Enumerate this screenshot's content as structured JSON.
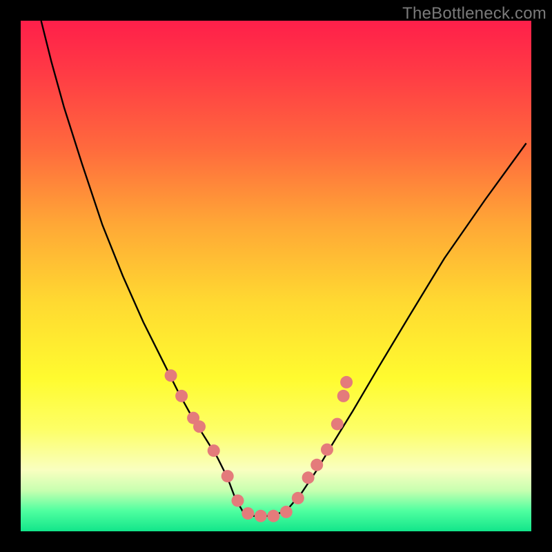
{
  "watermark": "TheBottleneck.com",
  "chart_data": {
    "type": "line",
    "title": "",
    "xlabel": "",
    "ylabel": "",
    "xlim": [
      0,
      1
    ],
    "ylim": [
      0,
      1
    ],
    "grid": false,
    "legend": false,
    "series": [
      {
        "name": "curve",
        "color": "#000000",
        "x": [
          0.04,
          0.06,
          0.085,
          0.12,
          0.16,
          0.2,
          0.24,
          0.28,
          0.31,
          0.335,
          0.36,
          0.385,
          0.405,
          0.42,
          0.44,
          0.46,
          0.49,
          0.52,
          0.55,
          0.58,
          0.61,
          0.65,
          0.7,
          0.76,
          0.83,
          0.91,
          0.99
        ],
        "y": [
          1.0,
          0.92,
          0.83,
          0.72,
          0.6,
          0.5,
          0.41,
          0.33,
          0.27,
          0.225,
          0.185,
          0.145,
          0.105,
          0.065,
          0.03,
          0.03,
          0.03,
          0.04,
          0.075,
          0.12,
          0.17,
          0.235,
          0.32,
          0.42,
          0.535,
          0.65,
          0.76
        ]
      }
    ],
    "markers": {
      "name": "dots",
      "color": "#e47b7b",
      "radius_px": 9,
      "x": [
        0.294,
        0.315,
        0.338,
        0.35,
        0.378,
        0.405,
        0.425,
        0.445,
        0.47,
        0.495,
        0.52,
        0.543,
        0.563,
        0.58,
        0.6,
        0.62,
        0.632,
        0.638
      ],
      "y": [
        0.305,
        0.265,
        0.222,
        0.205,
        0.158,
        0.108,
        0.06,
        0.035,
        0.03,
        0.03,
        0.038,
        0.065,
        0.105,
        0.13,
        0.16,
        0.21,
        0.265,
        0.292
      ]
    },
    "gradient_background": {
      "top_color": "#ff1f4a",
      "bottom_color": "#12e58a"
    }
  }
}
